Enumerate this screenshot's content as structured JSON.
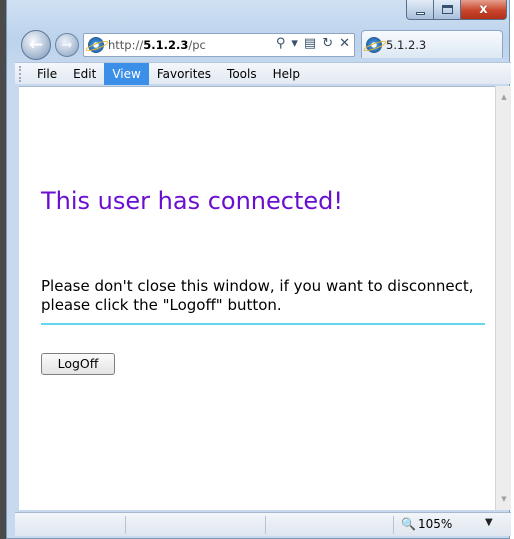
{
  "window": {
    "caption": {
      "minimize": "",
      "maximize": "",
      "close": "x"
    }
  },
  "nav": {
    "back": "←",
    "forward": "→",
    "address": {
      "prefix": "http://",
      "host": "5.1.2.3",
      "suffix": "/pc"
    },
    "address_icons": [
      "search-icon",
      "dropdown-icon",
      "compat-icon",
      "refresh-icon",
      "stop-icon"
    ],
    "address_icon_glyphs": [
      "⚲",
      "▾",
      "▤",
      "↻",
      "✕"
    ],
    "tab_title": "5.1.2.3"
  },
  "menu": {
    "items": [
      "File",
      "Edit",
      "View",
      "Favorites",
      "Tools",
      "Help"
    ],
    "active": "View"
  },
  "page": {
    "headline": "This user has connected!",
    "message": "Please don't close this window, if you want to disconnect, please click the \"Logoff\" button.",
    "button": "LogOff"
  },
  "status": {
    "zoom": "105%",
    "zoom_icon": "zoom-icon",
    "zoom_glyph": "🔍",
    "zoom_arrow": "▼"
  },
  "colors": {
    "headline": "#6a0fd0",
    "divider": "#67d7ee",
    "menu_active": "#3b8fe8",
    "close_button": "#c9442b"
  }
}
